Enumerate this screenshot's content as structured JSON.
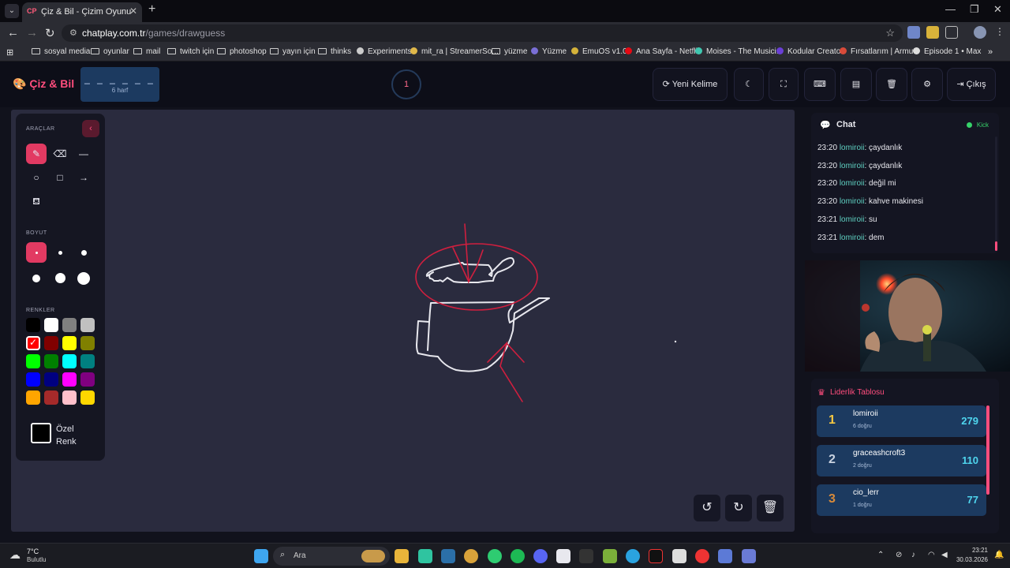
{
  "browser": {
    "tab_title": "Çiz & Bil - Çizim Oyunu",
    "tab_favicon": "CP",
    "url_host": "chatplay.com.tr",
    "url_path": "/games/drawguess",
    "bookmarks": [
      "sosyal media",
      "oyunlar",
      "mail",
      "twitch için",
      "photoshop",
      "yayın için",
      "thinks",
      "Experiments",
      "mit_ra | StreamerSo...",
      "yüzme",
      "Yüzme",
      "EmuOS v1.0",
      "Ana Sayfa - Netflix",
      "Moises - The Musici...",
      "Kodular Creator",
      "Fırsatlarım | Armut",
      "Episode 1 • Max"
    ]
  },
  "header": {
    "logo": "Çiz & Bil",
    "word_blanks": "_ _ _ _ _ _",
    "word_hint": "6 harf",
    "timer": "1",
    "new_word_label": "Yeni Kelime",
    "exit_label": "Çıkış"
  },
  "toolbox": {
    "tools_title": "ARAÇLAR",
    "size_title": "BOYUT",
    "colors_title": "RENKLER",
    "custom_color_label": "Özel Renk",
    "colors": [
      "#000000",
      "#ffffff",
      "#808080",
      "#c0c0c0",
      "#ff0000",
      "#800000",
      "#ffff00",
      "#808000",
      "#00ff00",
      "#008000",
      "#00ffff",
      "#008080",
      "#0000ff",
      "#000080",
      "#ff00ff",
      "#800080",
      "#ffa500",
      "#a52a2a",
      "#ffc0cb",
      "#ffd700"
    ]
  },
  "chat": {
    "title": "Chat",
    "status": "Kick",
    "messages": [
      {
        "time": "23:20",
        "user": "lomiroii",
        "text": ": çaydanlık"
      },
      {
        "time": "23:20",
        "user": "lomiroii",
        "text": ": çaydanlık"
      },
      {
        "time": "23:20",
        "user": "lomiroii",
        "text": ": değil mi"
      },
      {
        "time": "23:20",
        "user": "lomiroii",
        "text": ": kahve makinesi"
      },
      {
        "time": "23:21",
        "user": "lomiroii",
        "text": ": su"
      },
      {
        "time": "23:21",
        "user": "lomiroii",
        "text": ": dem"
      }
    ]
  },
  "leaderboard": {
    "title": "Liderlik Tablosu",
    "rows": [
      {
        "rank": "1",
        "name": "lomiroii",
        "sub": "6 doğru",
        "score": "279",
        "rank_color": "#f5c842"
      },
      {
        "rank": "2",
        "name": "graceashcroft3",
        "sub": "2 doğru",
        "score": "110",
        "rank_color": "#c9d2e0"
      },
      {
        "rank": "3",
        "name": "cio_lerr",
        "sub": "1 doğru",
        "score": "77",
        "rank_color": "#d98b3a"
      }
    ]
  },
  "taskbar": {
    "weather_temp": "7°C",
    "weather_desc": "Bulutlu",
    "search_label": "Ara",
    "time": "23:21",
    "date": "30.03.2026"
  }
}
